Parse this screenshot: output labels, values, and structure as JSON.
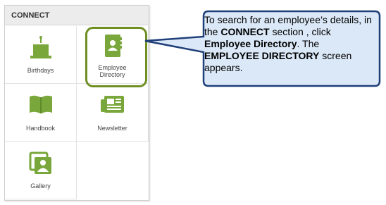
{
  "colors": {
    "icon_green": "#7aa73b",
    "highlight_green": "#6f8f23",
    "callout_fill": "#dbe8f7",
    "callout_border": "#1f3f78"
  },
  "connect_panel": {
    "title": "CONNECT",
    "tiles": [
      {
        "label": "Birthdays",
        "icon": "birthday-cake-icon"
      },
      {
        "label_line1": "Employee",
        "label_line2": "Directory",
        "icon": "address-book-icon",
        "highlighted": true
      },
      {
        "label": "Handbook",
        "icon": "open-book-icon"
      },
      {
        "label": "Newsletter",
        "icon": "newspaper-icon"
      },
      {
        "label": "Gallery",
        "icon": "photo-gallery-icon"
      }
    ]
  },
  "callout": {
    "t1": "To search for an employee’s details, in the ",
    "b1": "CONNECT",
    "t2": " section , click ",
    "b2": "Employee Directory",
    "t3": ". The ",
    "b3": "EMPLOYEE DIRECTORY",
    "t4": " screen appears."
  }
}
